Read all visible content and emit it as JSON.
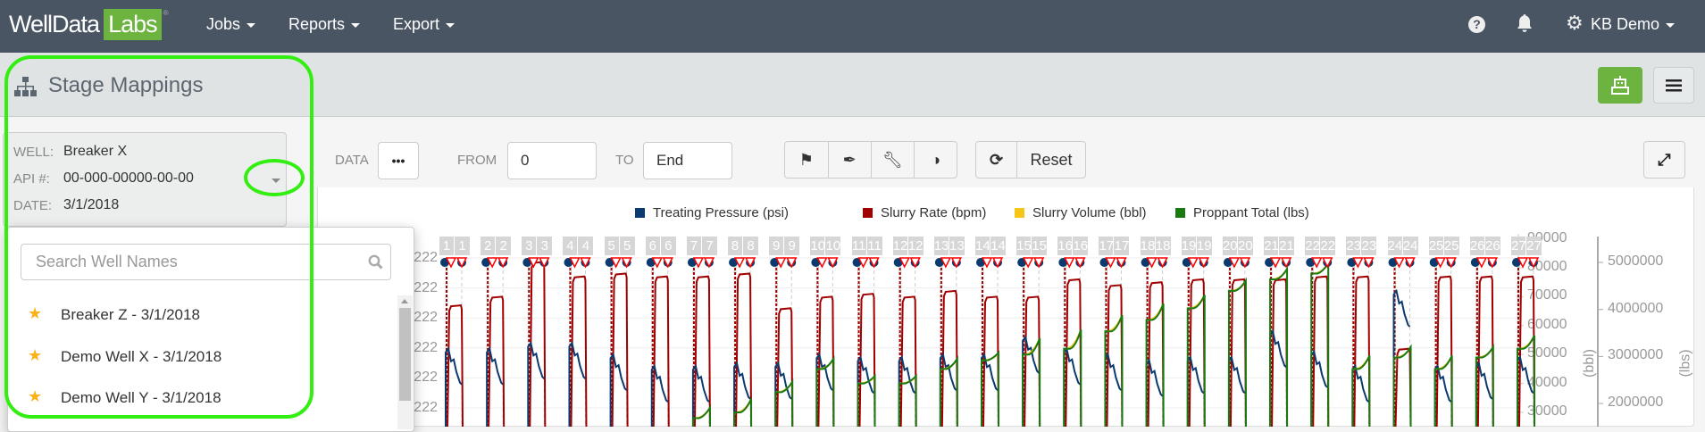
{
  "nav": {
    "logo_a": "Well",
    "logo_b": "Data",
    "logo_c": "Labs",
    "jobs": "Jobs",
    "reports": "Reports",
    "export": "Export",
    "user": "KB Demo",
    "icons": [
      "help-icon",
      "bell-icon",
      "gear-icon"
    ]
  },
  "header": {
    "title": "Stage Mappings"
  },
  "well": {
    "well_label": "WELL:",
    "well_value": "Breaker X",
    "api_label": "API #:",
    "api_value": "00-000-00000-00-00",
    "date_label": "DATE:",
    "date_value": "3/1/2018"
  },
  "dropdown": {
    "search_placeholder": "Search Well Names",
    "items": [
      {
        "label": "Breaker Z - 3/1/2018"
      },
      {
        "label": "Demo Well X - 3/1/2018"
      },
      {
        "label": "Demo Well Y - 3/1/2018"
      }
    ]
  },
  "toolbar": {
    "data_label": "DATA",
    "from_label": "FROM",
    "from_value": "0",
    "to_label": "TO",
    "to_value": "End",
    "reset": "Reset"
  },
  "colors": {
    "pressure": "#0b3a6e",
    "rate": "#a00000",
    "volume": "#f5c518",
    "proppant": "#1a7a12",
    "accent": "#6cb33f"
  },
  "chart_data": {
    "type": "line",
    "legend": [
      "Treating Pressure (psi)",
      "Slurry Rate (bpm)",
      "Slurry Volume (bbl)",
      "Proppant Total (lbs)"
    ],
    "left_axis_ticks": [
      "222",
      "222",
      "222",
      "222",
      "222",
      "222"
    ],
    "bbl_axis": {
      "label": "(bbl)",
      "ticks": [
        90000,
        80000,
        70000,
        60000,
        50000,
        40000,
        30000
      ]
    },
    "lbs_axis": {
      "label": "(lbs)",
      "ticks": [
        5000000,
        4000000,
        3000000,
        2000000
      ]
    },
    "stages": [
      {
        "a": "1",
        "b": "1"
      },
      {
        "a": "2",
        "b": "2"
      },
      {
        "a": "3",
        "b": "3"
      },
      {
        "a": "4",
        "b": "4"
      },
      {
        "a": "5",
        "b": "5"
      },
      {
        "a": "6",
        "b": "6"
      },
      {
        "a": "7",
        "b": "7"
      },
      {
        "a": "8",
        "b": "8"
      },
      {
        "a": "9",
        "b": "9"
      },
      {
        "a": "10",
        "b": "10"
      },
      {
        "a": "11",
        "b": "11"
      },
      {
        "a": "12",
        "b": "12"
      },
      {
        "a": "13",
        "b": "13"
      },
      {
        "a": "14",
        "b": "14"
      },
      {
        "a": "15",
        "b": "15"
      },
      {
        "a": "16",
        "b": "16"
      },
      {
        "a": "17",
        "b": "17"
      },
      {
        "a": "18",
        "b": "18"
      },
      {
        "a": "19",
        "b": "19"
      },
      {
        "a": "20",
        "b": "20"
      },
      {
        "a": "21",
        "b": "21"
      },
      {
        "a": "22",
        "b": "22"
      },
      {
        "a": "23",
        "b": "23"
      },
      {
        "a": "24",
        "b": "24"
      },
      {
        "a": "25",
        "b": "25"
      },
      {
        "a": "26",
        "b": "26"
      },
      {
        "a": "27",
        "b": "27"
      }
    ],
    "rate_peak_bbl": [
      67000,
      70000,
      82000,
      77000,
      78000,
      77000,
      77000,
      78000,
      66000,
      70000,
      71000,
      70000,
      72000,
      70000,
      70000,
      76000,
      74000,
      75000,
      76000,
      76000,
      76000,
      77000,
      77000,
      52000,
      77000,
      77000,
      77000
    ],
    "pressure_peak_bbl": [
      52000,
      52000,
      54000,
      54000,
      50000,
      46000,
      46000,
      47000,
      47000,
      50000,
      49000,
      49000,
      50000,
      50000,
      56000,
      52000,
      50000,
      48000,
      49000,
      49000,
      58000,
      51000,
      46000,
      72000,
      46000,
      47000,
      49000
    ],
    "proppant_start_bbl": [
      null,
      null,
      null,
      null,
      null,
      null,
      28000,
      30000,
      37000,
      45000,
      40000,
      40000,
      45000,
      48000,
      50000,
      52000,
      58000,
      62000,
      66000,
      72000,
      76000,
      78000,
      45000,
      49000,
      45000,
      49000,
      52000
    ],
    "proppant_end_bbl": [
      null,
      null,
      null,
      null,
      null,
      null,
      31000,
      34000,
      40000,
      48000,
      42000,
      42000,
      48000,
      50000,
      55000,
      58000,
      63000,
      67000,
      70000,
      75000,
      79000,
      81000,
      49000,
      52000,
      49000,
      52000,
      56000
    ]
  }
}
